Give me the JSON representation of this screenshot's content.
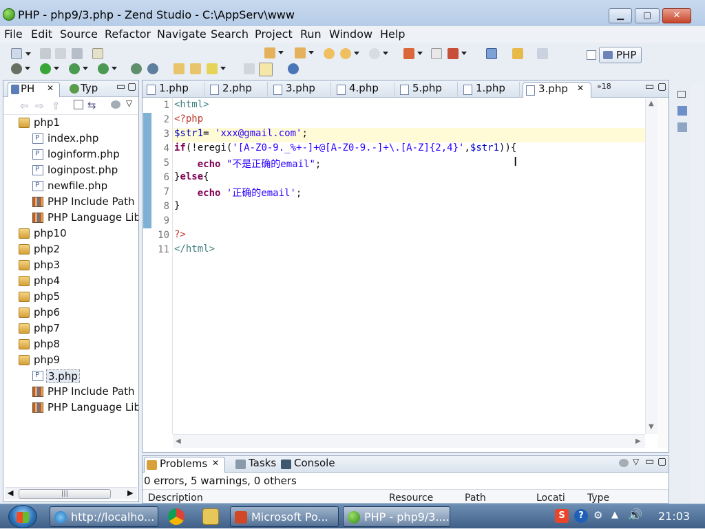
{
  "window": {
    "title": "PHP - php9/3.php - Zend Studio - C:\\AppServ\\www",
    "min": "▁",
    "max": "▢",
    "close": "✕"
  },
  "menu": [
    "File",
    "Edit",
    "Source",
    "Refactor",
    "Navigate",
    "Search",
    "Project",
    "Run",
    "Window",
    "Help"
  ],
  "perspective": {
    "label": "PHP"
  },
  "explorer": {
    "tabs": [
      {
        "label": "PH"
      },
      {
        "label": "Typ"
      }
    ],
    "tree": [
      {
        "label": "php1",
        "icon": "project-folder-icon",
        "level": 0
      },
      {
        "label": "index.php",
        "icon": "php-file-icon",
        "level": 1
      },
      {
        "label": "loginform.php",
        "icon": "php-file-icon",
        "level": 1
      },
      {
        "label": "loginpost.php",
        "icon": "php-file-icon",
        "level": 1
      },
      {
        "label": "newfile.php",
        "icon": "php-file-icon",
        "level": 1
      },
      {
        "label": "PHP Include Path",
        "icon": "library-icon",
        "level": 1
      },
      {
        "label": "PHP Language Lib",
        "icon": "library-icon",
        "level": 1
      },
      {
        "label": "php10",
        "icon": "project-folder-icon",
        "level": 0
      },
      {
        "label": "php2",
        "icon": "project-folder-icon",
        "level": 0
      },
      {
        "label": "php3",
        "icon": "project-folder-icon",
        "level": 0
      },
      {
        "label": "php4",
        "icon": "project-folder-icon",
        "level": 0
      },
      {
        "label": "php5",
        "icon": "project-folder-icon",
        "level": 0
      },
      {
        "label": "php6",
        "icon": "project-folder-icon",
        "level": 0
      },
      {
        "label": "php7",
        "icon": "project-folder-icon",
        "level": 0
      },
      {
        "label": "php8",
        "icon": "project-folder-icon",
        "level": 0
      },
      {
        "label": "php9",
        "icon": "project-folder-icon",
        "level": 0
      },
      {
        "label": "3.php",
        "icon": "php-file-icon",
        "level": 1,
        "selected": true
      },
      {
        "label": "PHP Include Path",
        "icon": "library-icon",
        "level": 1
      },
      {
        "label": "PHP Language Lib",
        "icon": "library-icon",
        "level": 1
      }
    ]
  },
  "editor": {
    "tabs": [
      {
        "label": "1.php"
      },
      {
        "label": "2.php"
      },
      {
        "label": "3.php"
      },
      {
        "label": "4.php"
      },
      {
        "label": "5.php"
      },
      {
        "label": "1.php"
      },
      {
        "label": "3.php",
        "active": true
      }
    ],
    "overflow": "»18",
    "line_numbers": [
      "1",
      "2",
      "3",
      "4",
      "5",
      "6",
      "7",
      "8",
      "9",
      "10",
      "11"
    ],
    "code": [
      [
        {
          "t": "<html>",
          "c": "t"
        }
      ],
      [
        {
          "t": "<?php",
          "c": "p"
        }
      ],
      [
        {
          "t": "$str1",
          "c": "v"
        },
        {
          "t": "= ",
          "c": ""
        },
        {
          "t": "'xxx@gmail.com'",
          "c": "s"
        },
        {
          "t": ";",
          "c": ""
        }
      ],
      [
        {
          "t": "if",
          "c": "k"
        },
        {
          "t": "(!eregi(",
          "c": ""
        },
        {
          "t": "'[A-Z0-9._%+-]+@[A-Z0-9.-]+\\.[A-Z]{2,4}'",
          "c": "s"
        },
        {
          "t": ",",
          "c": ""
        },
        {
          "t": "$str1",
          "c": "v"
        },
        {
          "t": ")){",
          "c": ""
        }
      ],
      [
        {
          "t": "    ",
          "c": ""
        },
        {
          "t": "echo",
          "c": "k"
        },
        {
          "t": " ",
          "c": ""
        },
        {
          "t": "\"不是正确的email\"",
          "c": "s"
        },
        {
          "t": ";",
          "c": ""
        }
      ],
      [
        {
          "t": "}",
          "c": ""
        },
        {
          "t": "else",
          "c": "k"
        },
        {
          "t": "{",
          "c": ""
        }
      ],
      [
        {
          "t": "    ",
          "c": ""
        },
        {
          "t": "echo",
          "c": "k"
        },
        {
          "t": " ",
          "c": ""
        },
        {
          "t": "'正确的email'",
          "c": "s"
        },
        {
          "t": ";",
          "c": ""
        }
      ],
      [
        {
          "t": "}",
          "c": ""
        }
      ],
      [
        {
          "t": "",
          "c": ""
        }
      ],
      [
        {
          "t": "?>",
          "c": "p"
        }
      ],
      [
        {
          "t": "</html>",
          "c": "t"
        }
      ]
    ]
  },
  "bottom": {
    "tabs": [
      {
        "label": "Problems"
      },
      {
        "label": "Tasks"
      },
      {
        "label": "Console"
      }
    ],
    "summary": "0 errors, 5 warnings, 0 others",
    "columns": [
      "Description",
      "Resource",
      "Path",
      "Locati",
      "Type"
    ]
  },
  "taskbar": {
    "tasks": [
      {
        "label": "http://localho...",
        "icon": "ie-icon"
      },
      {
        "label": "Microsoft Po...",
        "icon": "powerpoint-icon"
      },
      {
        "label": "PHP - php9/3....",
        "icon": "zend-icon",
        "active": true
      }
    ],
    "clock": "21:03"
  },
  "colors": {
    "keyword": "#7f0055",
    "string": "#2a00ff",
    "variable": "#0000c0",
    "tag": "#3f7f7f",
    "highlight": "#fffbd6"
  }
}
